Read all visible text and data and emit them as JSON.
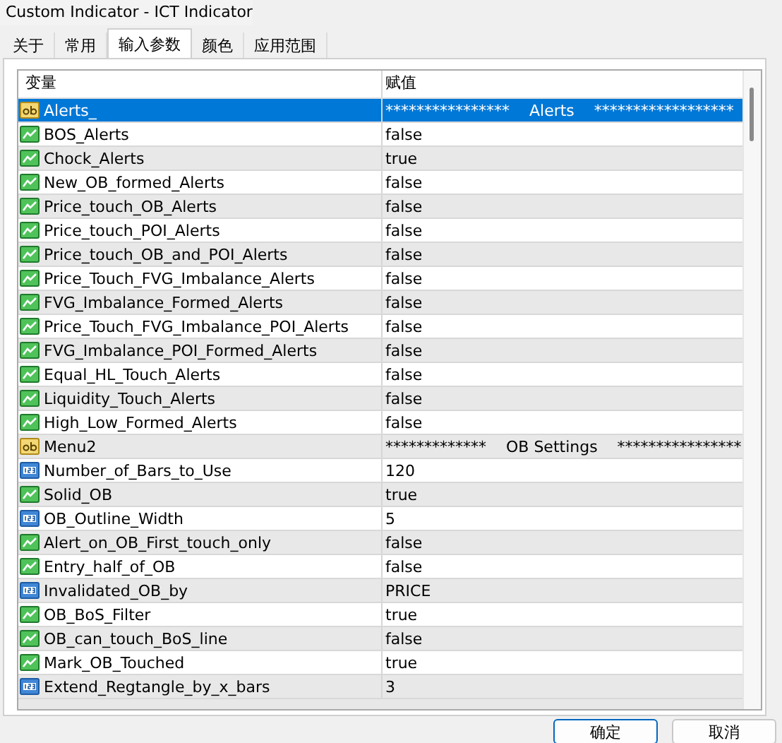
{
  "window": {
    "title": "Custom Indicator - ICT Indicator"
  },
  "tabs": [
    {
      "label": "关于",
      "selected": false
    },
    {
      "label": "常用",
      "selected": false
    },
    {
      "label": "输入参数",
      "selected": true
    },
    {
      "label": "颜色",
      "selected": false
    },
    {
      "label": "应用范围",
      "selected": false
    }
  ],
  "table": {
    "columns": [
      "变量",
      "赋值"
    ],
    "rows": [
      {
        "kind": "string",
        "name": "Alerts_",
        "value": "****************    Alerts    ******************",
        "selected": true
      },
      {
        "kind": "bool",
        "name": "BOS_Alerts",
        "value": "false",
        "selected": false
      },
      {
        "kind": "bool",
        "name": "Chock_Alerts",
        "value": "true",
        "selected": false
      },
      {
        "kind": "bool",
        "name": "New_OB_formed_Alerts",
        "value": "false",
        "selected": false
      },
      {
        "kind": "bool",
        "name": "Price_touch_OB_Alerts",
        "value": "false",
        "selected": false
      },
      {
        "kind": "bool",
        "name": "Price_touch_POI_Alerts",
        "value": "false",
        "selected": false
      },
      {
        "kind": "bool",
        "name": "Price_touch_OB_and_POI_Alerts",
        "value": "false",
        "selected": false
      },
      {
        "kind": "bool",
        "name": "Price_Touch_FVG_Imbalance_Alerts",
        "value": "false",
        "selected": false
      },
      {
        "kind": "bool",
        "name": "FVG_Imbalance_Formed_Alerts",
        "value": "false",
        "selected": false
      },
      {
        "kind": "bool",
        "name": "Price_Touch_FVG_Imbalance_POI_Alerts",
        "value": "false",
        "selected": false
      },
      {
        "kind": "bool",
        "name": "FVG_Imbalance_POI_Formed_Alerts",
        "value": "false",
        "selected": false
      },
      {
        "kind": "bool",
        "name": "Equal_HL_Touch_Alerts",
        "value": "false",
        "selected": false
      },
      {
        "kind": "bool",
        "name": "Liquidity_Touch_Alerts",
        "value": "false",
        "selected": false
      },
      {
        "kind": "bool",
        "name": "High_Low_Formed_Alerts",
        "value": "false",
        "selected": false
      },
      {
        "kind": "string",
        "name": "Menu2",
        "value": "*************    OB Settings    ****************",
        "selected": false
      },
      {
        "kind": "int",
        "name": "Number_of_Bars_to_Use",
        "value": "120",
        "selected": false
      },
      {
        "kind": "bool",
        "name": "Solid_OB",
        "value": "true",
        "selected": false
      },
      {
        "kind": "int",
        "name": "OB_Outline_Width",
        "value": "5",
        "selected": false
      },
      {
        "kind": "bool",
        "name": "Alert_on_OB_First_touch_only",
        "value": "false",
        "selected": false
      },
      {
        "kind": "bool",
        "name": "Entry_half_of_OB",
        "value": "false",
        "selected": false
      },
      {
        "kind": "int",
        "name": "Invalidated_OB_by",
        "value": "PRICE",
        "selected": false
      },
      {
        "kind": "bool",
        "name": "OB_BoS_Filter",
        "value": "true",
        "selected": false
      },
      {
        "kind": "bool",
        "name": "OB_can_touch_BoS_line",
        "value": "false",
        "selected": false
      },
      {
        "kind": "bool",
        "name": "Mark_OB_Touched",
        "value": "true",
        "selected": false
      },
      {
        "kind": "int",
        "name": "Extend_Regtangle_by_x_bars",
        "value": "3",
        "selected": false
      }
    ]
  },
  "buttons": [
    "确定",
    "取消"
  ]
}
